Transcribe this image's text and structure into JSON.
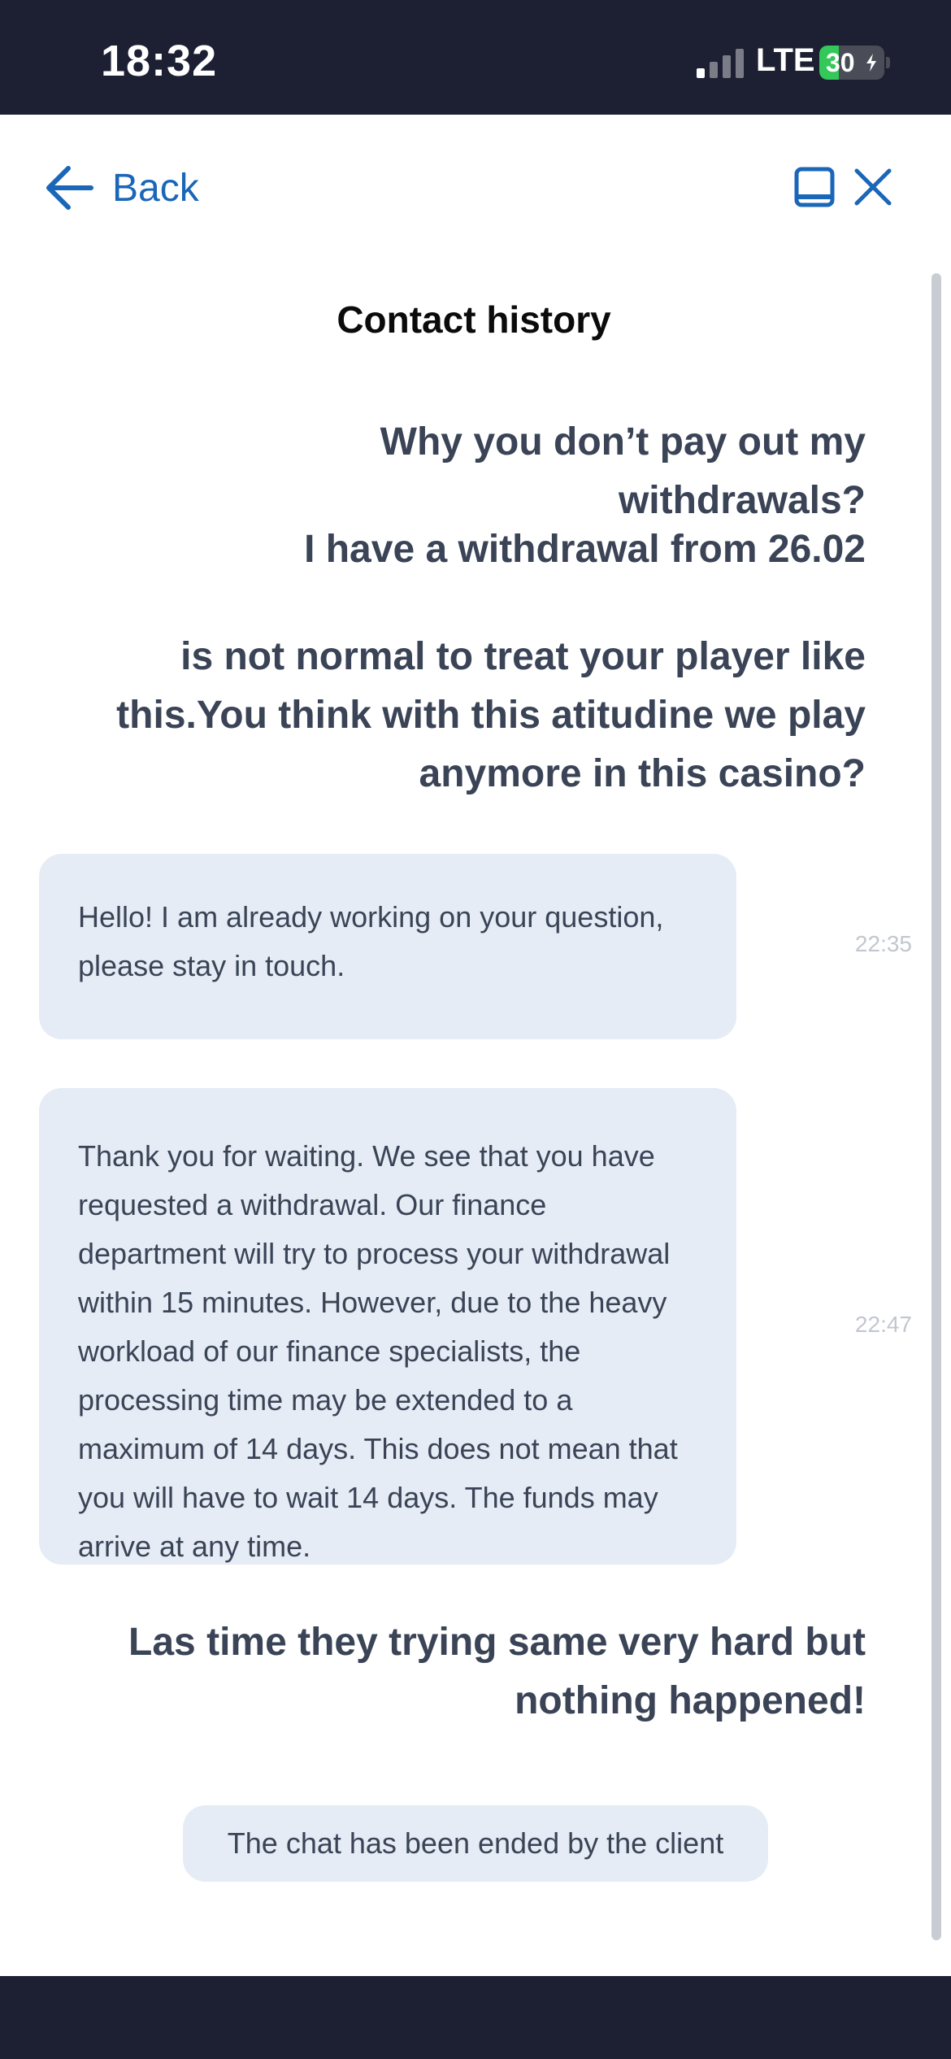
{
  "status_bar": {
    "time": "18:32",
    "network": "LTE",
    "battery_level": "30",
    "battery_percent": 30,
    "signal_bars_active": 1
  },
  "header": {
    "back_label": "Back",
    "minimize_icon": "window-minimize-icon",
    "close_icon": "close-icon"
  },
  "page": {
    "title": "Contact history"
  },
  "messages": [
    {
      "from": "client",
      "text": "Why you don’t pay out my withdrawals?"
    },
    {
      "from": "client",
      "text": "I have a withdrawal from 26.02"
    },
    {
      "from": "client",
      "text": "is not normal to treat your player like this.You think with this atitudine we play anymore in this casino?"
    },
    {
      "from": "support",
      "text": "Hello! I am already working on your question, please stay in touch.",
      "time": "22:35"
    },
    {
      "from": "support",
      "text": "Thank you for waiting. We see that you have requested a withdrawal. Our finance department will try to process your withdrawal within 15 minutes. However, due to the heavy workload of our finance specialists, the processing time may be extended to a maximum of 14 days. This does not mean that you will have to wait 14 days. The funds may arrive at any time.",
      "time": "22:47"
    },
    {
      "from": "client",
      "text": "Las time they trying same very hard but nothing happened!"
    }
  ],
  "chat_status": "The chat has been ended by the client",
  "colors": {
    "status_bar_bg": "#1c2032",
    "accent_blue": "#1a66b8",
    "bubble_bg": "#e5ecf5",
    "text_dark": "#3a4456",
    "battery_green": "#34c759"
  }
}
